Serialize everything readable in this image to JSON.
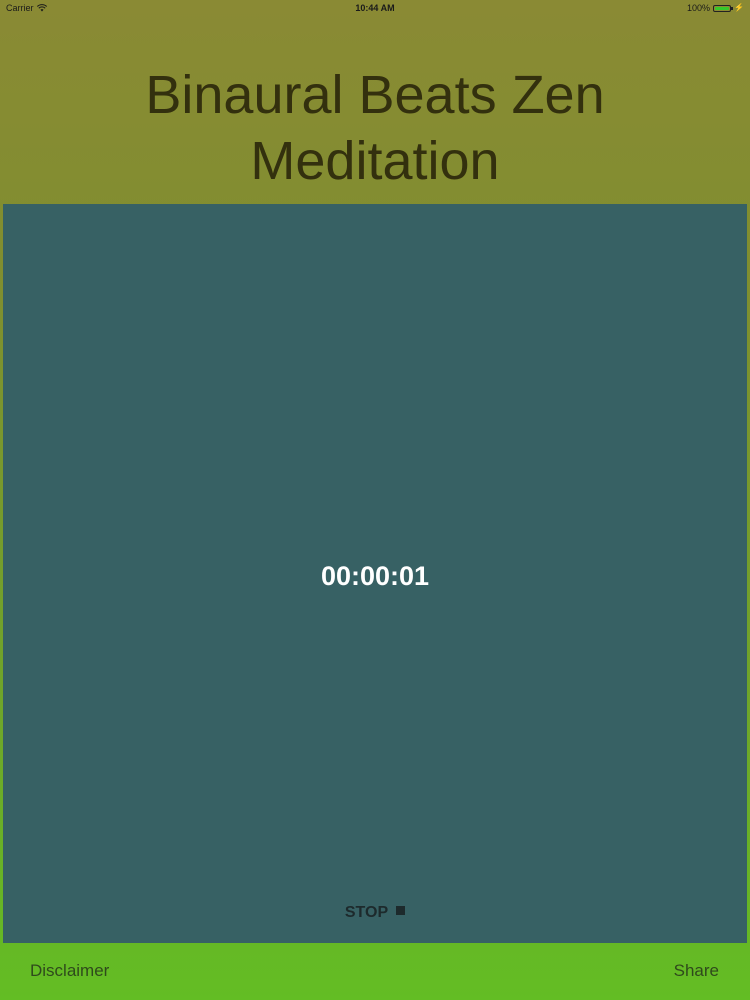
{
  "status_bar": {
    "carrier": "Carrier",
    "time": "10:44 AM",
    "battery": "100%",
    "icons": [
      "wifi-icon",
      "battery-icon",
      "charging-icon"
    ]
  },
  "header": {
    "title_line1": "Binaural Beats Zen",
    "title_line2": "Meditation"
  },
  "main": {
    "timer": "00:00:01",
    "stop_label": "STOP",
    "stop_icon": "stop-icon"
  },
  "footer": {
    "disclaimer_label": "Disclaimer",
    "share_label": "Share"
  },
  "colors": {
    "panel": "#376164",
    "header_text": "#33300e",
    "top_gradient": "#8a8a34",
    "bottom_gradient": "#63bd24"
  }
}
